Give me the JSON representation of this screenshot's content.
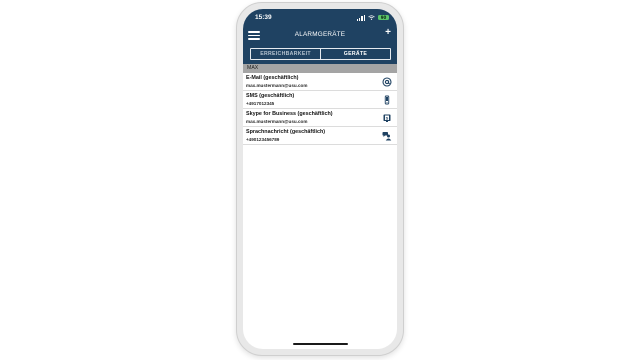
{
  "status_bar": {
    "time": "15:39",
    "battery": "90"
  },
  "header": {
    "title": "ALARMGERÄTE",
    "add_label": "+"
  },
  "tabs": [
    {
      "label": "ERREICHBARKEIT",
      "active": false
    },
    {
      "label": "GERÄTE",
      "active": true
    }
  ],
  "section": {
    "label": "MAX"
  },
  "devices": [
    {
      "title": "E-Mail (geschäftlich)",
      "subtitle": "max.mustermann@usu.com",
      "icon": "at-icon"
    },
    {
      "title": "SMS (geschäftlich)",
      "subtitle": "+4917012345",
      "icon": "mobile-phone-icon"
    },
    {
      "title": "Skype for Business (geschäftlich)",
      "subtitle": "max.mustermann@usu.com",
      "icon": "skype-business-icon"
    },
    {
      "title": "Sprachnachricht (geschäftlich)",
      "subtitle": "+490123456789",
      "icon": "voice-message-icon"
    }
  ],
  "colors": {
    "header": "#1f4262",
    "accent": "#1f4262",
    "section": "#a4a4a4",
    "battery": "#5ac36b"
  }
}
